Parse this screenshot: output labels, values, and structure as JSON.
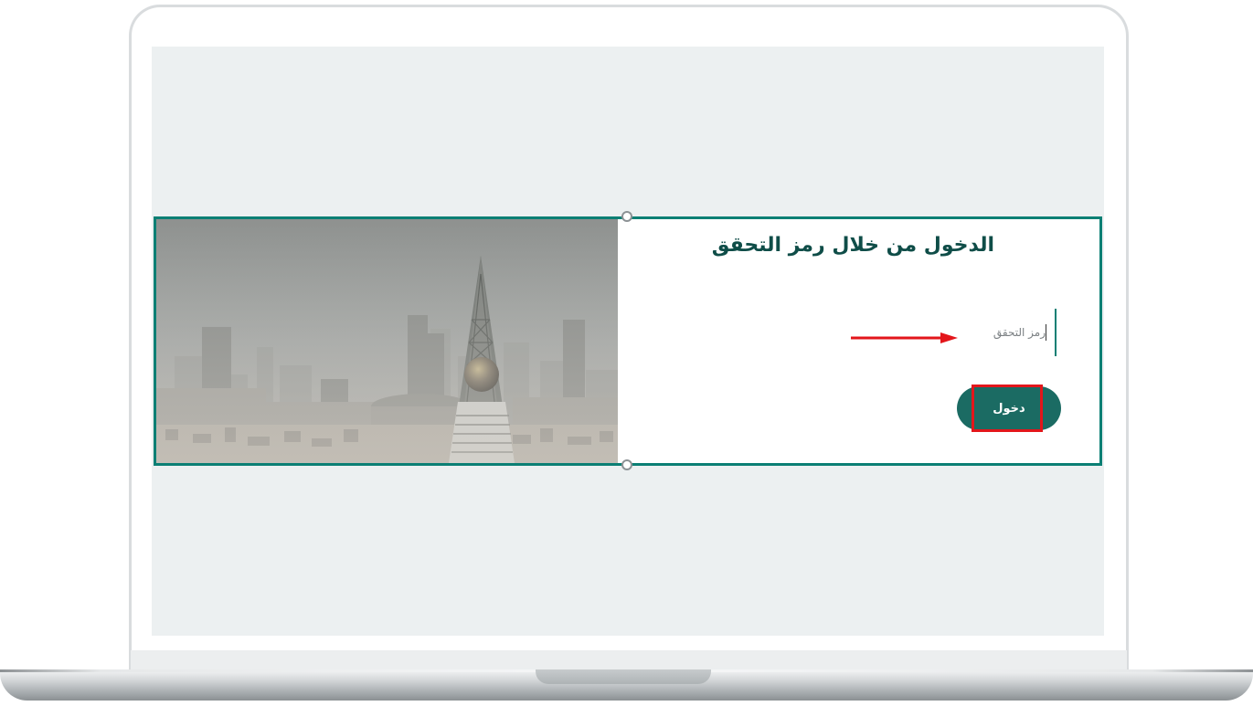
{
  "login_card": {
    "title": "الدخول من خلال رمز التحقق",
    "otp_field": {
      "placeholder": "رمز التحقق",
      "value": ""
    },
    "login_button_label": "دخول",
    "accent_color": "#0b7f74",
    "button_color": "#1b6b63"
  },
  "annotations": {
    "arrow_color": "#e3161b",
    "highlight_color": "#e3161b"
  },
  "icons": {
    "hero_image": "riyadh-skyline-faisaliah-tower-image",
    "arrow": "red-arrow-right-icon"
  }
}
